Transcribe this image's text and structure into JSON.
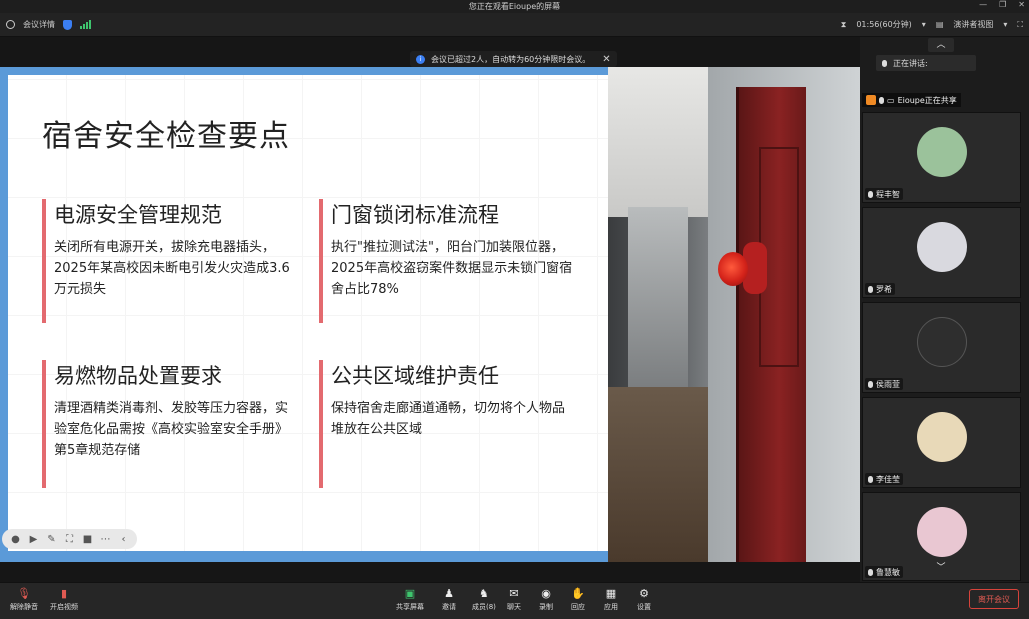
{
  "window": {
    "title": "您正在观看Eioupe的屏幕",
    "controls": [
      "—",
      "❐",
      "✕"
    ]
  },
  "infobar": {
    "meeting_details": "会议详情",
    "timer": "01:56(60分钟)",
    "view_mode": "演讲者视图"
  },
  "notice": {
    "text": "会议已超过2人，自动转为60分钟限时会议。"
  },
  "slide": {
    "title": "宿舍安全检查要点",
    "cards": [
      {
        "heading": "电源安全管理规范",
        "body": "关闭所有电源开关，拔除充电器插头，2025年某高校因未断电引发火灾造成3.6万元损失"
      },
      {
        "heading": "门窗锁闭标准流程",
        "body": "执行\"推拉测试法\"，阳台门加装限位器，2025年高校盗窃案件数据显示未锁门窗宿舍占比78%"
      },
      {
        "heading": "易燃物品处置要求",
        "body": "清理酒精类消毒剂、发胶等压力容器，实验室危化品需按《高校实验室安全手册》第5章规范存储"
      },
      {
        "heading": "公共区域维护责任",
        "body": "保持宿舍走廊通道通畅，切勿将个人物品堆放在公共区域"
      }
    ]
  },
  "panel": {
    "speaking_label": "正在讲话:",
    "sharing_label": "Eioupe正在共享",
    "participants": [
      {
        "name": "程丰智",
        "avatar_color": "#9bc29b"
      },
      {
        "name": "罗希",
        "avatar_color": "#d9d9df"
      },
      {
        "name": "侯雨萱",
        "avatar_color": "#2e2e2e"
      },
      {
        "name": "李佳莹",
        "avatar_color": "#e8d9b8"
      },
      {
        "name": "鲁慧敏",
        "avatar_color": "#e9c7d2"
      }
    ]
  },
  "toolbar": {
    "mute": "解除静音",
    "video": "开启视频",
    "share": "共享屏幕",
    "invite": "邀请",
    "members": "成员(8)",
    "chat": "聊天",
    "record": "录制",
    "reactions": "回应",
    "apps": "应用",
    "settings": "设置",
    "leave": "离开会议"
  },
  "colors": {
    "accent_blue": "#5b9ad8",
    "card_bar": "#e36a6f",
    "leave_red": "#d7433b"
  }
}
